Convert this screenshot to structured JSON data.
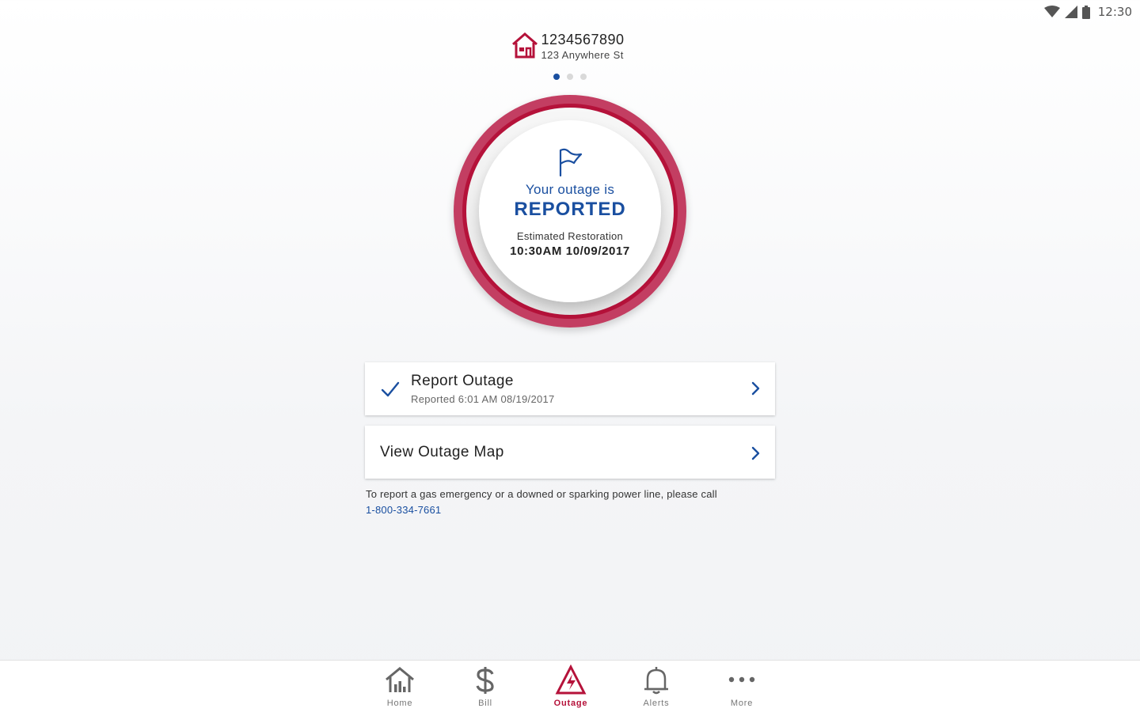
{
  "status_bar": {
    "time": "12:30",
    "icons": [
      "wifi-icon",
      "signal-icon",
      "battery-icon"
    ]
  },
  "account": {
    "icon": "house-icon",
    "number": "1234567890",
    "address": "123 Anywhere St",
    "pages": 3,
    "current_page": 1
  },
  "outage_status": {
    "icon": "flag-icon",
    "line1": "Your outage is",
    "status": "REPORTED",
    "restoration_label": "Estimated Restoration",
    "restoration_value": "10:30AM 10/09/2017"
  },
  "cards": {
    "report": {
      "title": "Report Outage",
      "subtitle": "Reported 6:01 AM 08/19/2017",
      "icon": "check-icon"
    },
    "map": {
      "title": "View Outage Map"
    }
  },
  "emergency": {
    "text": "To report a gas emergency or a downed or sparking power line, please call",
    "phone": "1-800-334-7661"
  },
  "nav": {
    "items": [
      {
        "label": "Home",
        "icon": "home-icon"
      },
      {
        "label": "Bill",
        "icon": "dollar-icon"
      },
      {
        "label": "Outage",
        "icon": "outage-icon",
        "active": true
      },
      {
        "label": "Alerts",
        "icon": "bell-icon"
      },
      {
        "label": "More",
        "icon": "more-icon"
      }
    ]
  },
  "colors": {
    "brand_red": "#b5123a",
    "brand_blue": "#1a4fa0"
  }
}
